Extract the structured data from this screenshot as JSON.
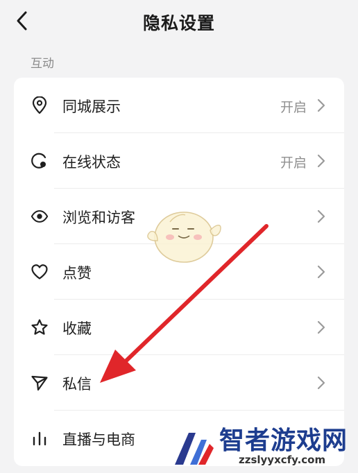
{
  "header": {
    "title": "隐私设置",
    "back_icon": "chevron-left-icon"
  },
  "section": {
    "label": "互动"
  },
  "items": [
    {
      "label": "同城展示",
      "value": "开启",
      "icon": "location-pin-icon"
    },
    {
      "label": "在线状态",
      "value": "开启",
      "icon": "online-status-icon"
    },
    {
      "label": "浏览和访客",
      "value": "",
      "icon": "eye-icon"
    },
    {
      "label": "点赞",
      "value": "",
      "icon": "heart-icon"
    },
    {
      "label": "收藏",
      "value": "",
      "icon": "star-icon"
    },
    {
      "label": "私信",
      "value": "",
      "icon": "send-icon"
    },
    {
      "label": "直播与电商",
      "value": "",
      "icon": "bar-chart-icon"
    }
  ],
  "annotation": {
    "arrow_color": "#e0262a",
    "points_to": "私信"
  },
  "watermark": {
    "title": "智者游戏网",
    "url": "zzslyyxcfy.com"
  },
  "colors": {
    "background": "#f3f3f4",
    "card": "#ffffff",
    "text": "#1f1f1f",
    "muted": "#8f8f8f",
    "brand": "#1d3d8f"
  }
}
